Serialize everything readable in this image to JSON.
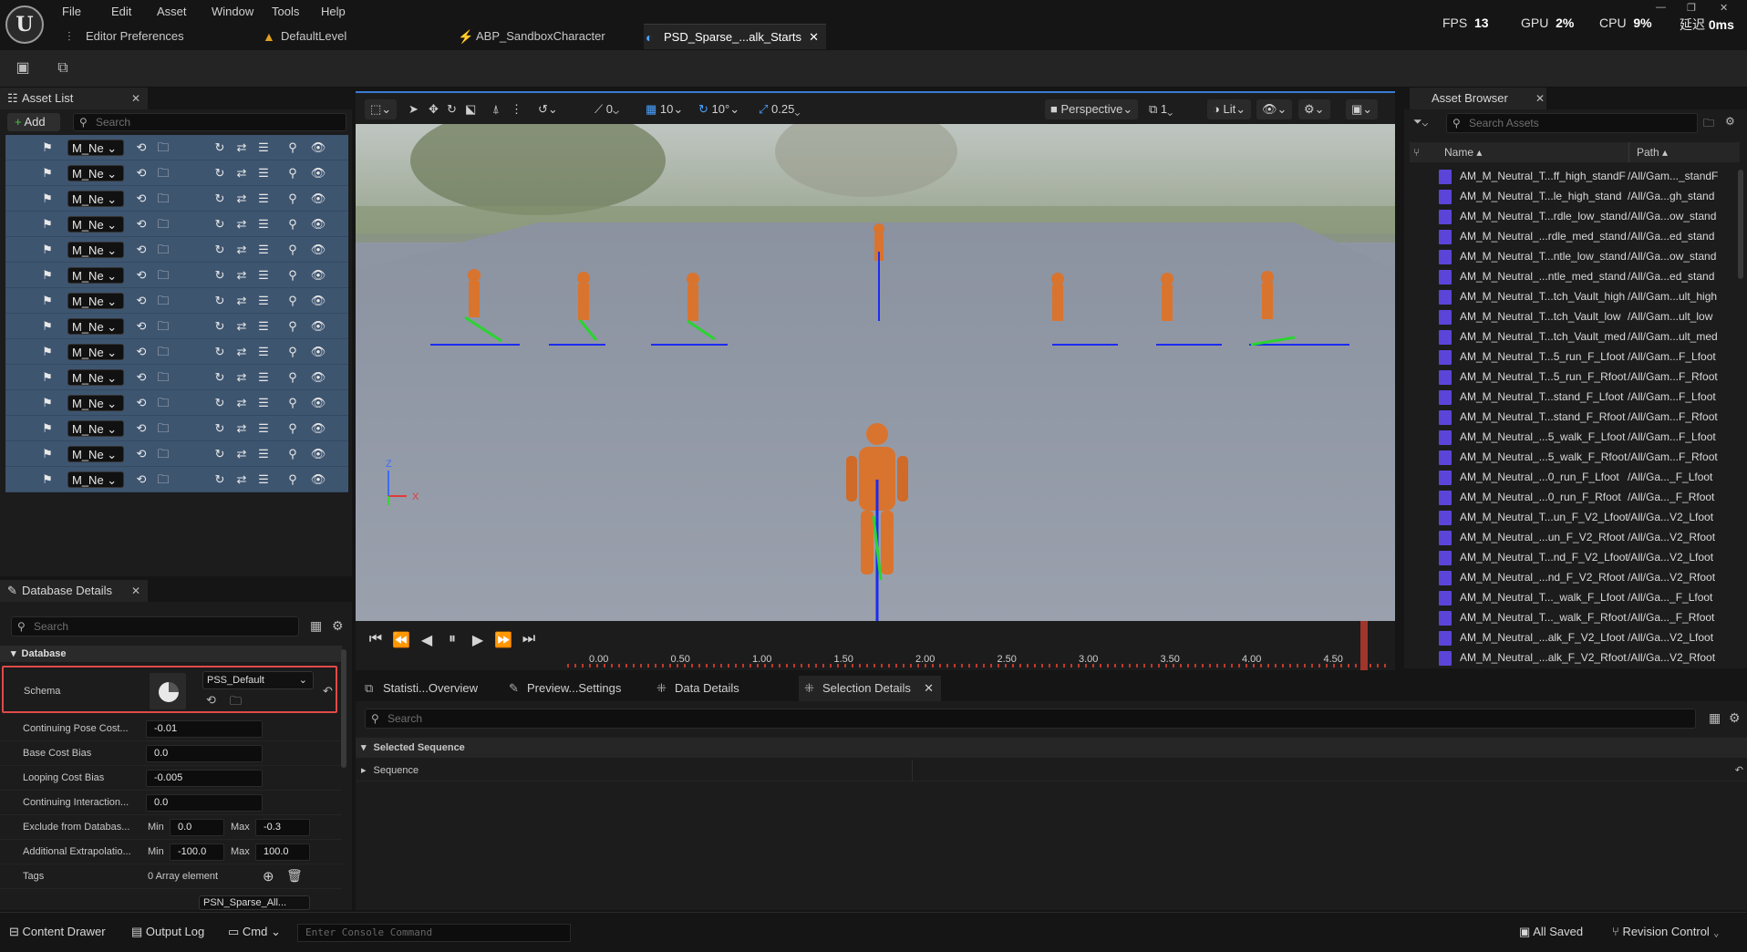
{
  "menu": [
    "File",
    "Edit",
    "Asset",
    "Window",
    "Tools",
    "Help"
  ],
  "doc_tabs": [
    {
      "label": "Editor Preferences",
      "icon": "sliders-icon"
    },
    {
      "label": "DefaultLevel",
      "icon": "level-icon"
    },
    {
      "label": "ABP_SandboxCharacter",
      "icon": "anim-blueprint-icon"
    },
    {
      "label": "PSD_Sparse_...alk_Starts",
      "icon": "pose-search-icon",
      "active": true
    }
  ],
  "stats": {
    "fps_label": "FPS",
    "fps": "13",
    "gpu_label": "GPU",
    "gpu": "2%",
    "cpu_label": "CPU",
    "cpu": "9%",
    "latency_label": "延迟",
    "latency": "0ms"
  },
  "asset_list": {
    "title": "Asset List",
    "add_label": "Add",
    "search_placeholder": "Search",
    "row_value": "M_Ne",
    "rows": 14
  },
  "database_details": {
    "title": "Database Details",
    "search_placeholder": "Search",
    "section": "Database",
    "schema_label": "Schema",
    "schema_value": "PSS_Default",
    "properties": [
      {
        "label": "Continuing Pose Cost...",
        "value": "-0.01"
      },
      {
        "label": "Base Cost Bias",
        "value": "0.0"
      },
      {
        "label": "Looping Cost Bias",
        "value": "-0.005"
      },
      {
        "label": "Continuing Interaction...",
        "value": "0.0"
      }
    ],
    "exclude": {
      "label": "Exclude from Databas...",
      "min_label": "Min",
      "min": "0.0",
      "max_label": "Max",
      "max": "-0.3"
    },
    "extrapolation": {
      "label": "Additional Extrapolatio...",
      "min_label": "Min",
      "min": "-100.0",
      "max_label": "Max",
      "max": "100.0"
    },
    "tags": {
      "label": "Tags",
      "value": "0 Array element"
    },
    "cut_value": "PSN_Sparse_All..."
  },
  "viewport_toolbar": {
    "snap_angle": "0",
    "grid": "10",
    "rotation": "10°",
    "scale": "0.25",
    "perspective": "Perspective",
    "camera_speed": "1",
    "lit": "Lit"
  },
  "timeline": {
    "ticks": [
      "0.00",
      "0.50",
      "1.00",
      "1.50",
      "2.00",
      "2.50",
      "3.00",
      "3.50",
      "4.00",
      "4.50"
    ]
  },
  "asset_browser": {
    "title": "Asset Browser",
    "search_placeholder": "Search Assets",
    "col_name": "Name",
    "col_path": "Path",
    "rows": [
      {
        "name": "AM_M_Neutral_T...ff_high_standF",
        "path": "/All/Gam..._standF"
      },
      {
        "name": "AM_M_Neutral_T...le_high_stand",
        "path": "/All/Ga...gh_stand"
      },
      {
        "name": "AM_M_Neutral_T...rdle_low_stand",
        "path": "/All/Ga...ow_stand"
      },
      {
        "name": "AM_M_Neutral_...rdle_med_stand",
        "path": "/All/Ga...ed_stand"
      },
      {
        "name": "AM_M_Neutral_T...ntle_low_stand",
        "path": "/All/Ga...ow_stand"
      },
      {
        "name": "AM_M_Neutral_...ntle_med_stand",
        "path": "/All/Ga...ed_stand"
      },
      {
        "name": "AM_M_Neutral_T...tch_Vault_high",
        "path": "/All/Gam...ult_high"
      },
      {
        "name": "AM_M_Neutral_T...tch_Vault_low",
        "path": "/All/Gam...ult_low"
      },
      {
        "name": "AM_M_Neutral_T...tch_Vault_med",
        "path": "/All/Gam...ult_med"
      },
      {
        "name": "AM_M_Neutral_T...5_run_F_Lfoot",
        "path": "/All/Gam...F_Lfoot"
      },
      {
        "name": "AM_M_Neutral_T...5_run_F_Rfoot",
        "path": "/All/Gam...F_Rfoot"
      },
      {
        "name": "AM_M_Neutral_T...stand_F_Lfoot",
        "path": "/All/Gam...F_Lfoot"
      },
      {
        "name": "AM_M_Neutral_T...stand_F_Rfoot",
        "path": "/All/Gam...F_Rfoot"
      },
      {
        "name": "AM_M_Neutral_...5_walk_F_Lfoot",
        "path": "/All/Gam...F_Lfoot"
      },
      {
        "name": "AM_M_Neutral_...5_walk_F_Rfoot",
        "path": "/All/Gam...F_Rfoot"
      },
      {
        "name": "AM_M_Neutral_...0_run_F_Lfoot",
        "path": "/All/Ga..._F_Lfoot"
      },
      {
        "name": "AM_M_Neutral_...0_run_F_Rfoot",
        "path": "/All/Ga..._F_Rfoot"
      },
      {
        "name": "AM_M_Neutral_T...un_F_V2_Lfoot",
        "path": "/All/Ga...V2_Lfoot"
      },
      {
        "name": "AM_M_Neutral_...un_F_V2_Rfoot",
        "path": "/All/Ga...V2_Rfoot"
      },
      {
        "name": "AM_M_Neutral_T...nd_F_V2_Lfoot",
        "path": "/All/Ga...V2_Lfoot"
      },
      {
        "name": "AM_M_Neutral_...nd_F_V2_Rfoot",
        "path": "/All/Ga...V2_Rfoot"
      },
      {
        "name": "AM_M_Neutral_T..._walk_F_Lfoot",
        "path": "/All/Ga..._F_Lfoot"
      },
      {
        "name": "AM_M_Neutral_T..._walk_F_Rfoot",
        "path": "/All/Ga..._F_Rfoot"
      },
      {
        "name": "AM_M_Neutral_...alk_F_V2_Lfoot",
        "path": "/All/Ga...V2_Lfoot"
      },
      {
        "name": "AM_M_Neutral_...alk_F_V2_Rfoot",
        "path": "/All/Ga...V2_Rfoot"
      }
    ]
  },
  "bottom_tabs": [
    {
      "label": "Statisti...Overview",
      "icon": "stats-icon"
    },
    {
      "label": "Preview...Settings",
      "icon": "pencil-icon"
    },
    {
      "label": "Data Details",
      "icon": "details-icon"
    },
    {
      "label": "Selection Details",
      "icon": "details-icon",
      "active": true
    }
  ],
  "selection_details": {
    "search_placeholder": "Search",
    "section": "Selected Sequence",
    "row": "Sequence"
  },
  "statusbar": {
    "content_drawer": "Content Drawer",
    "output_log": "Output Log",
    "cmd": "Cmd",
    "console_placeholder": "Enter Console Command",
    "all_saved": "All Saved",
    "revision_control": "Revision Control"
  },
  "axis": {
    "z": "Z",
    "x": "X"
  },
  "colors": {
    "accent": "#3a7bd5",
    "selection_row": "#3e5570",
    "highlight_border": "#e04a4a",
    "asset_icon": "#5b45d8",
    "scrub": "#c0392b"
  }
}
